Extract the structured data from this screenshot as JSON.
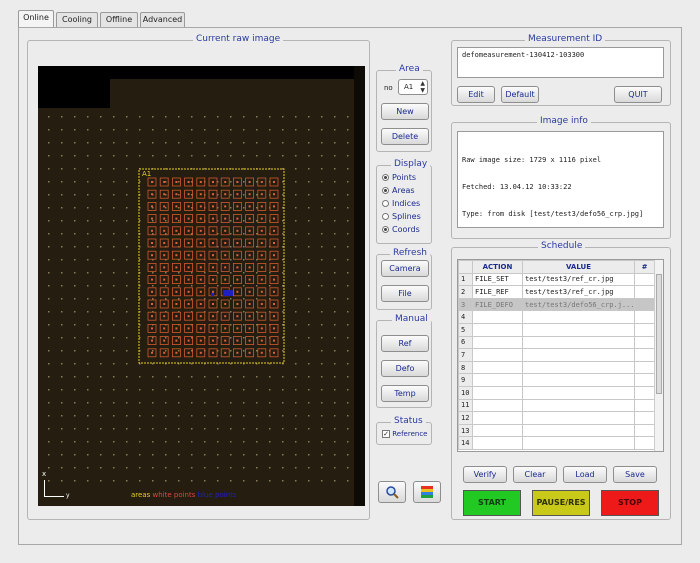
{
  "tabs": [
    {
      "label": "Online",
      "active": true
    },
    {
      "label": "Cooling",
      "active": false
    },
    {
      "label": "Offline",
      "active": false
    },
    {
      "label": "Advanced",
      "active": false
    }
  ],
  "raw_image": {
    "title": "Current raw image",
    "area_label": "A1",
    "axis_x": "y",
    "axis_y": "x",
    "legend": {
      "areas": "areas",
      "white_points": "white points",
      "blue_points": "blue points"
    }
  },
  "area": {
    "title": "Area",
    "no_label": "no",
    "selected": "A1",
    "new_label": "New",
    "delete_label": "Delete"
  },
  "display": {
    "title": "Display",
    "options": [
      {
        "label": "Points",
        "checked": true
      },
      {
        "label": "Areas",
        "checked": true
      },
      {
        "label": "Indices",
        "checked": false
      },
      {
        "label": "Splines",
        "checked": false
      },
      {
        "label": "Coords",
        "checked": true
      }
    ]
  },
  "refresh": {
    "title": "Refresh",
    "camera_label": "Camera",
    "file_label": "File"
  },
  "manual": {
    "title": "Manual",
    "ref_label": "Ref",
    "defo_label": "Defo",
    "temp_label": "Temp"
  },
  "status": {
    "title": "Status",
    "reference_label": "Reference",
    "reference_checked": true
  },
  "measurement": {
    "title": "Measurement ID",
    "value": "defomeasurement-130412-103300",
    "edit_label": "Edit",
    "default_label": "Default",
    "quit_label": "QUIT"
  },
  "image_info": {
    "title": "Image info",
    "lines": [
      "Raw image size: 1729 x 1116 pixel",
      "Fetched: 13.04.12 10:33:22",
      "Type: from disk [test/test3/defo56_crp.jpg]"
    ]
  },
  "schedule": {
    "title": "Schedule",
    "columns": [
      "",
      "ACTION",
      "VALUE",
      "#"
    ],
    "rows": [
      {
        "idx": "1",
        "action": "FILE_SET",
        "value": "test/test3/ref_cr.jpg",
        "count": ""
      },
      {
        "idx": "2",
        "action": "FILE_REF",
        "value": "test/test3/ref_cr.jpg",
        "count": ""
      },
      {
        "idx": "3",
        "action": "FILE_DEFO",
        "value": "test/test3/defo56_crp.j...",
        "count": ""
      },
      {
        "idx": "4",
        "action": "",
        "value": "",
        "count": ""
      },
      {
        "idx": "5",
        "action": "",
        "value": "",
        "count": ""
      },
      {
        "idx": "6",
        "action": "",
        "value": "",
        "count": ""
      },
      {
        "idx": "7",
        "action": "",
        "value": "",
        "count": ""
      },
      {
        "idx": "8",
        "action": "",
        "value": "",
        "count": ""
      },
      {
        "idx": "9",
        "action": "",
        "value": "",
        "count": ""
      },
      {
        "idx": "10",
        "action": "",
        "value": "",
        "count": ""
      },
      {
        "idx": "11",
        "action": "",
        "value": "",
        "count": ""
      },
      {
        "idx": "12",
        "action": "",
        "value": "",
        "count": ""
      },
      {
        "idx": "13",
        "action": "",
        "value": "",
        "count": ""
      },
      {
        "idx": "14",
        "action": "",
        "value": "",
        "count": ""
      }
    ],
    "selected_row": 2,
    "verify_label": "Verify",
    "clear_label": "Clear",
    "load_label": "Load",
    "save_label": "Save",
    "start_label": "START",
    "pause_label": "PAUSE/RES",
    "stop_label": "STOP"
  },
  "icons": {
    "zoom": "magnifier-icon",
    "palette": "color-palette-icon"
  },
  "colors": {
    "title_blue": "#2a3aa0",
    "start_green": "#22c922",
    "pause_yellow": "#c9c91a",
    "stop_red": "#ee1a1a",
    "areas_yellow": "#e8d020",
    "white_points": "#d84a40",
    "blue_points": "#2020c0"
  }
}
